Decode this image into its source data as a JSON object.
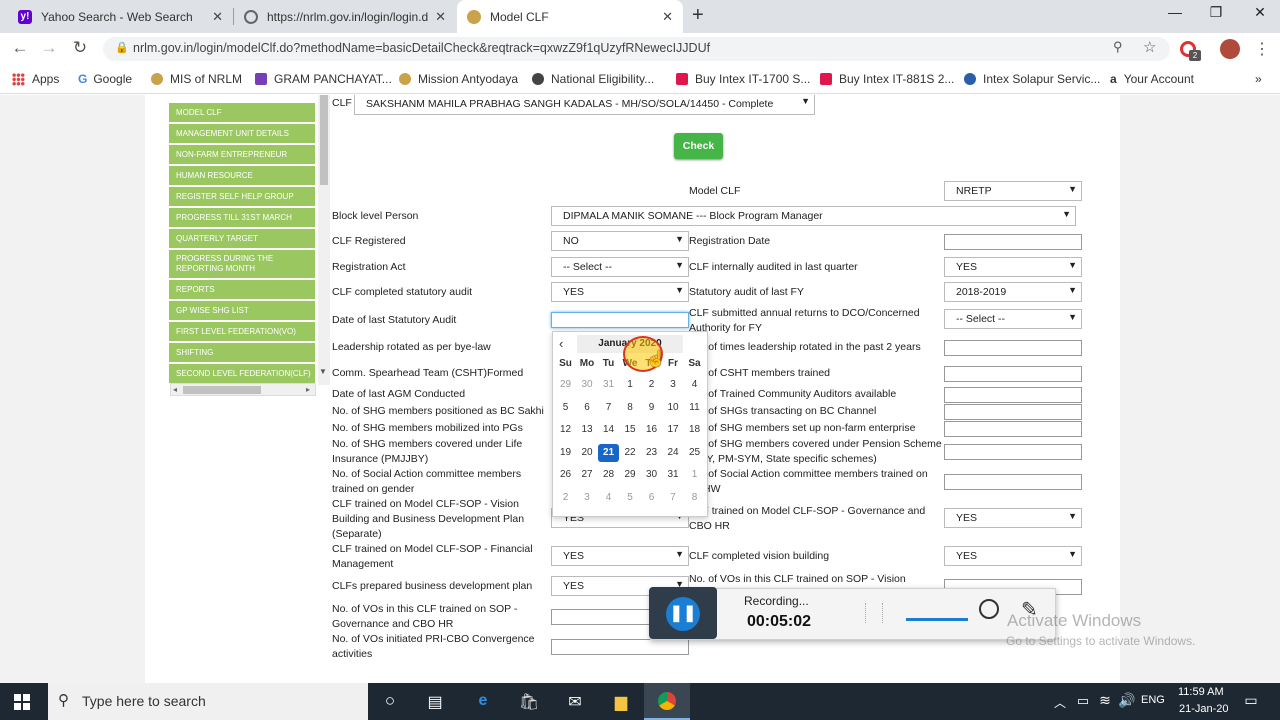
{
  "browser": {
    "tabs": [
      {
        "label": "Yahoo Search - Web Search",
        "favicon_color": "#6001d2"
      },
      {
        "label": "https://nrlm.gov.in/login/login.d",
        "favicon_color": "#888888"
      },
      {
        "label": "Model CLF",
        "favicon_color": "#c9a24a"
      }
    ],
    "url": "nrlm.gov.in/login/modelClf.do?methodName=basicDetailCheck&reqtrack=qxwzZ9f1qUzyfRNewecIJJDUf",
    "bookmarks": [
      {
        "label": "Apps",
        "icon_color": "#e04040"
      },
      {
        "label": "Google",
        "icon_color": "#4285f4"
      },
      {
        "label": "MIS of NRLM",
        "icon_color": "#c9a24a"
      },
      {
        "label": "GRAM PANCHAYAT...",
        "icon_color": "#7a3db8"
      },
      {
        "label": "Mission Antyodaya",
        "icon_color": "#c9a24a"
      },
      {
        "label": "National Eligibility...",
        "icon_color": "#444444"
      },
      {
        "label": "Buy Intex IT-1700 S...",
        "icon_color": "#e0174f"
      },
      {
        "label": "Buy Intex IT-881S 2...",
        "icon_color": "#e0174f"
      },
      {
        "label": "Intex Solapur Servic...",
        "icon_color": "#2a5fa8"
      },
      {
        "label": "Your Account",
        "icon_color": "#222222"
      }
    ],
    "extension_badge": "2"
  },
  "sidebar": {
    "items": [
      "MODEL CLF",
      "MANAGEMENT UNIT DETAILS",
      "NON-FARM ENTREPRENEUR",
      "HUMAN RESOURCE",
      "REGISTER SELF HELP GROUP",
      "PROGRESS TILL 31ST MARCH",
      "QUARTERLY TARGET",
      "PROGRESS DURING THE REPORTING MONTH",
      "REPORTS",
      "GP WISE SHG LIST",
      "FIRST LEVEL FEDERATION(VO)",
      "SHIFTING",
      "SECOND LEVEL FEDERATION(CLF)"
    ]
  },
  "form": {
    "clf_label": "CLF",
    "clf_value": "SAKSHANM MAHILA PRABHAG SANGH KADALAS   -  MH/SO/SOLA/14450  -  Complete",
    "check_button": "Check",
    "model_clf_label": "Model CLF",
    "model_clf_value": "NRETP",
    "block_person_label": "Block level Person",
    "block_person_value": "DIPMALA MANIK SOMANE --- Block Program Manager",
    "left": [
      {
        "label": "CLF Registered",
        "value": "NO"
      },
      {
        "label": "Registration Act",
        "value": "-- Select --"
      },
      {
        "label": "CLF completed statutory audit",
        "value": "YES"
      },
      {
        "label": "Date of last Statutory Audit",
        "value": ""
      },
      {
        "label": "Leadership rotated as per bye-law"
      },
      {
        "label": "Comm. Spearhead Team (CSHT)Formed"
      },
      {
        "label": "Date of last AGM Conducted"
      },
      {
        "label": "No. of SHG members positioned as BC Sakhi"
      },
      {
        "label": "No. of SHG members mobilized into PGs"
      },
      {
        "label": "No. of SHG members covered under Life Insurance (PMJJBY)"
      },
      {
        "label": "No. of Social Action committee members trained on gender"
      },
      {
        "label": "CLF trained on Model CLF-SOP - Vision Building and Business Development Plan (Separate)",
        "value": "YES"
      },
      {
        "label": "CLF trained on Model CLF-SOP - Financial Management",
        "value": "YES"
      },
      {
        "label": "CLFs prepared business development plan",
        "value": "YES"
      },
      {
        "label": "No. of VOs in this CLF trained on SOP - Governance and CBO HR"
      },
      {
        "label": "No. of VOs initiated PRI-CBO Convergence activities"
      }
    ],
    "right": [
      {
        "label": "Registration Date"
      },
      {
        "label": "CLF internally audited in last quarter",
        "value": "YES"
      },
      {
        "label": "Statutory audit of last FY",
        "value": "2018-2019"
      },
      {
        "label": "CLF submitted annual returns to DCO/Concerned Authority for FY",
        "value": "-- Select --"
      },
      {
        "label": "No. of times leadership rotated in the past 2 years"
      },
      {
        "label": "No. of CSHT members trained"
      },
      {
        "label": "No. of Trained Community Auditors available"
      },
      {
        "label": "No. of SHGs transacting on BC Channel"
      },
      {
        "label": "No. of SHG members set up non-farm enterprise"
      },
      {
        "label": "No. of SHG members covered under Pension Scheme (APY, PM-SYM, State specific schemes)"
      },
      {
        "label": "No. of Social Action committee members trained on FNHW"
      },
      {
        "label": "CLF trained on Model CLF-SOP - Governance and CBO HR",
        "value": "YES"
      },
      {
        "label": "CLF completed vision building",
        "value": "YES"
      },
      {
        "label": "No. of VOs in this CLF trained on SOP - Vision"
      }
    ]
  },
  "datepicker": {
    "month_label": "January 2020",
    "weekdays": [
      "Su",
      "Mo",
      "Tu",
      "We",
      "Th",
      "Fr",
      "Sa"
    ],
    "weeks": [
      [
        "29",
        "30",
        "31",
        "1",
        "2",
        "3",
        "4"
      ],
      [
        "5",
        "6",
        "7",
        "8",
        "9",
        "10",
        "11"
      ],
      [
        "12",
        "13",
        "14",
        "15",
        "16",
        "17",
        "18"
      ],
      [
        "19",
        "20",
        "21",
        "22",
        "23",
        "24",
        "25"
      ],
      [
        "26",
        "27",
        "28",
        "29",
        "30",
        "31",
        "1"
      ],
      [
        "2",
        "3",
        "4",
        "5",
        "6",
        "7",
        "8"
      ]
    ],
    "selected_day": "21",
    "highlight_color": "#1766c8"
  },
  "recorder": {
    "status": "Recording...",
    "elapsed": "00:05:02"
  },
  "watermark": {
    "title": "Activate Windows",
    "subtitle": "Go to Settings to activate Windows."
  },
  "taskbar": {
    "search_placeholder": "Type here to search",
    "language": "ENG",
    "time": "11:59 AM",
    "date": "21-Jan-20"
  }
}
